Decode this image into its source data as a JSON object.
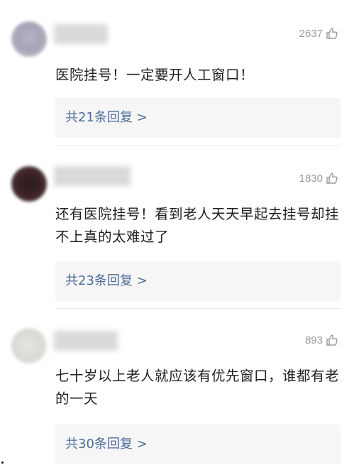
{
  "comments": [
    {
      "likes": "2637",
      "text": "医院挂号！一定要开人工窗口！",
      "replies": "共21条回复 >"
    },
    {
      "likes": "1830",
      "text": "还有医院挂号！看到老人天天早起去挂号却挂不上真的太难过了",
      "replies": "共23条回复 >"
    },
    {
      "likes": "893",
      "text": "七十岁以上老人就应该有优先窗口，谁都有老的一天",
      "replies": "共30条回复 >"
    }
  ],
  "icons": {
    "like": "thumbs-up-outline-icon"
  },
  "colors": {
    "reply_link": "#4d6c99",
    "like_count": "#9a9a9a",
    "reply_bg": "#f6f6f6"
  }
}
